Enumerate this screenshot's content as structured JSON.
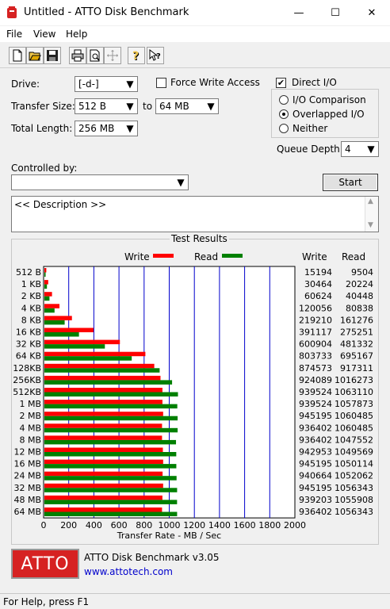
{
  "window": {
    "title": "Untitled - ATTO Disk Benchmark",
    "minimize": "—",
    "maximize": "☐",
    "close": "✕"
  },
  "menu": {
    "file": "File",
    "view": "View",
    "help": "Help"
  },
  "toolbar": {
    "icons": [
      "new-file-icon",
      "open-folder-icon",
      "save-icon",
      "print-icon",
      "print-preview-icon",
      "move-icon",
      "help-icon",
      "context-help-icon"
    ]
  },
  "settings": {
    "drive_label": "Drive:",
    "drive_value": "[-d-]",
    "force_write_label": "Force Write Access",
    "force_write_checked": false,
    "direct_io_label": "Direct I/O",
    "direct_io_checked": true,
    "transfer_size_label": "Transfer Size:",
    "transfer_size_from": "512 B",
    "to_label": "to",
    "transfer_size_to": "64 MB",
    "total_length_label": "Total Length:",
    "total_length_value": "256 MB",
    "io_comparison_label": "I/O Comparison",
    "overlapped_io_label": "Overlapped I/O",
    "neither_label": "Neither",
    "selected_mode": "Overlapped I/O",
    "queue_depth_label": "Queue Depth:",
    "queue_depth_value": "4",
    "controlled_by_label": "Controlled by:",
    "controlled_by_value": "",
    "start_label": "Start",
    "description_text": "<< Description >>"
  },
  "results": {
    "title": "Test Results",
    "write_legend": "Write",
    "read_legend": "Read",
    "write_col_header": "Write",
    "read_col_header": "Read",
    "write_color": "#ff0000",
    "read_color": "#008000"
  },
  "chart_data": {
    "type": "bar",
    "orientation": "horizontal",
    "categories": [
      "512 B",
      "1 KB",
      "2 KB",
      "4 KB",
      "8 KB",
      "16 KB",
      "32 KB",
      "64 KB",
      "128KB",
      "256KB",
      "512KB",
      "1 MB",
      "2 MB",
      "4 MB",
      "8 MB",
      "12 MB",
      "16 MB",
      "24 MB",
      "32 MB",
      "48 MB",
      "64 MB"
    ],
    "series": [
      {
        "name": "Write",
        "values": [
          15194,
          30464,
          60624,
          120056,
          219210,
          391117,
          600904,
          803733,
          874573,
          924089,
          939524,
          939524,
          945195,
          936402,
          936402,
          942953,
          945195,
          940664,
          945195,
          939203,
          936402
        ]
      },
      {
        "name": "Read",
        "values": [
          9504,
          20224,
          40448,
          80838,
          161276,
          275251,
          481332,
          695167,
          917311,
          1016273,
          1063110,
          1057873,
          1060485,
          1060485,
          1047552,
          1049569,
          1050114,
          1052062,
          1056343,
          1055908,
          1056343
        ]
      }
    ],
    "xlabel": "Transfer Rate - MB / Sec",
    "xlim": [
      0,
      2000
    ],
    "xticks": [
      0,
      200,
      400,
      600,
      800,
      1000,
      1200,
      1400,
      1600,
      1800,
      2000
    ],
    "grid": true,
    "legend": "top"
  },
  "footer": {
    "logo_text": "ATTO",
    "product_name": "ATTO Disk Benchmark v3.05",
    "url": "www.attotech.com"
  },
  "status": {
    "text": "For Help, press F1"
  }
}
